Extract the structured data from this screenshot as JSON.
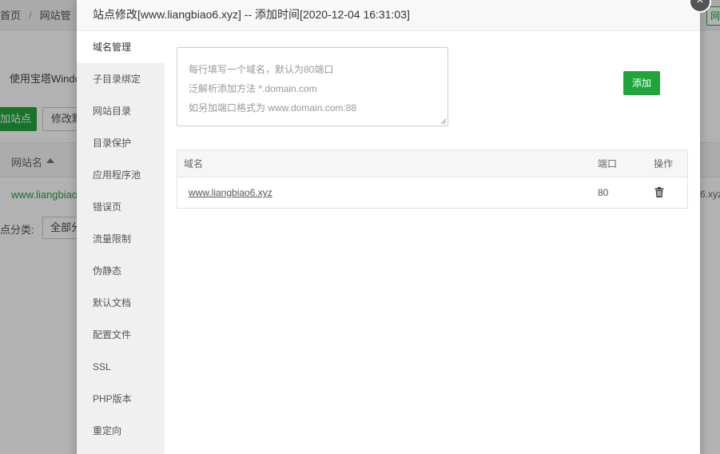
{
  "background": {
    "breadcrumb": {
      "home": "首页",
      "separator": "/",
      "current": "网站管"
    },
    "corner_button": "网",
    "notice": "使用宝塔Windo",
    "add_site_button": "加站点",
    "modify_button": "修改默",
    "table_header_name": "网站名",
    "site_row_name": "www.liangbiao",
    "site_row_right": "6.xyz",
    "category_label": "点分类:",
    "category_value": "全部分"
  },
  "modal": {
    "title": "站点修改[www.liangbiao6.xyz] -- 添加时间[2020-12-04 16:31:03]",
    "close_icon": "×",
    "sidebar": {
      "items": [
        {
          "label": "域名管理",
          "active": true
        },
        {
          "label": "子目录绑定"
        },
        {
          "label": "网站目录"
        },
        {
          "label": "目录保护"
        },
        {
          "label": "应用程序池"
        },
        {
          "label": "错误页"
        },
        {
          "label": "流量限制"
        },
        {
          "label": "伪静态"
        },
        {
          "label": "默认文档"
        },
        {
          "label": "配置文件"
        },
        {
          "label": "SSL"
        },
        {
          "label": "PHP版本"
        },
        {
          "label": "重定向"
        }
      ]
    },
    "domain_input": {
      "value": "",
      "placeholder_lines": [
        "每行填写一个域名，默认为80端口",
        "泛解析添加方法 *.domain.com",
        "如另加端口格式为 www.domain.com:88"
      ]
    },
    "add_button": "添加",
    "table": {
      "headers": {
        "domain": "域名",
        "port": "端口",
        "action": "操作"
      },
      "rows": [
        {
          "domain": "www.liangbiao6.xyz",
          "port": "80",
          "action_icon": "trash-icon"
        }
      ]
    }
  },
  "colors": {
    "accent": "#20a53a",
    "overlay": "rgba(0,0,0,0.3)",
    "sidebar_bg": "#f0f0f0"
  }
}
